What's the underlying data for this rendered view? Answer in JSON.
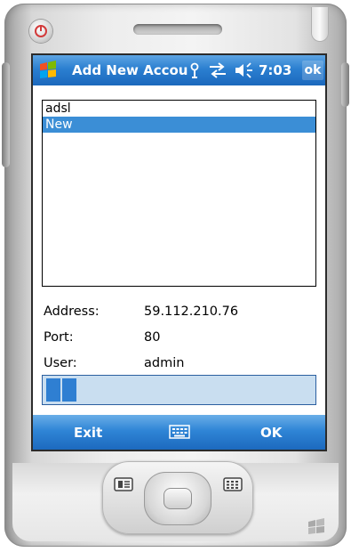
{
  "window": {
    "title": "Add New Accou",
    "clock": "7:03",
    "ok_label": "ok"
  },
  "list": {
    "items": [
      {
        "label": "adsl",
        "selected": false
      },
      {
        "label": "New",
        "selected": true
      }
    ]
  },
  "fields": {
    "address_label": "Address:",
    "address_value": "59.112.210.76",
    "port_label": "Port:",
    "port_value": "80",
    "user_label": "User:",
    "user_value": "admin"
  },
  "progress": {
    "indeterminate": true
  },
  "softkeys": {
    "left_label": "Exit",
    "right_label": "OK"
  },
  "icons": {
    "start": "windows-start-icon",
    "signal": "antenna-icon",
    "connectivity": "sync-arrows-icon",
    "volume": "speaker-icon",
    "keyboard": "keyboard-icon"
  },
  "colors": {
    "titlebar": "#2b7fd0",
    "selection": "#3b8ed6",
    "progress_track": "#c9def0",
    "progress_fill": "#2f7fd2"
  }
}
